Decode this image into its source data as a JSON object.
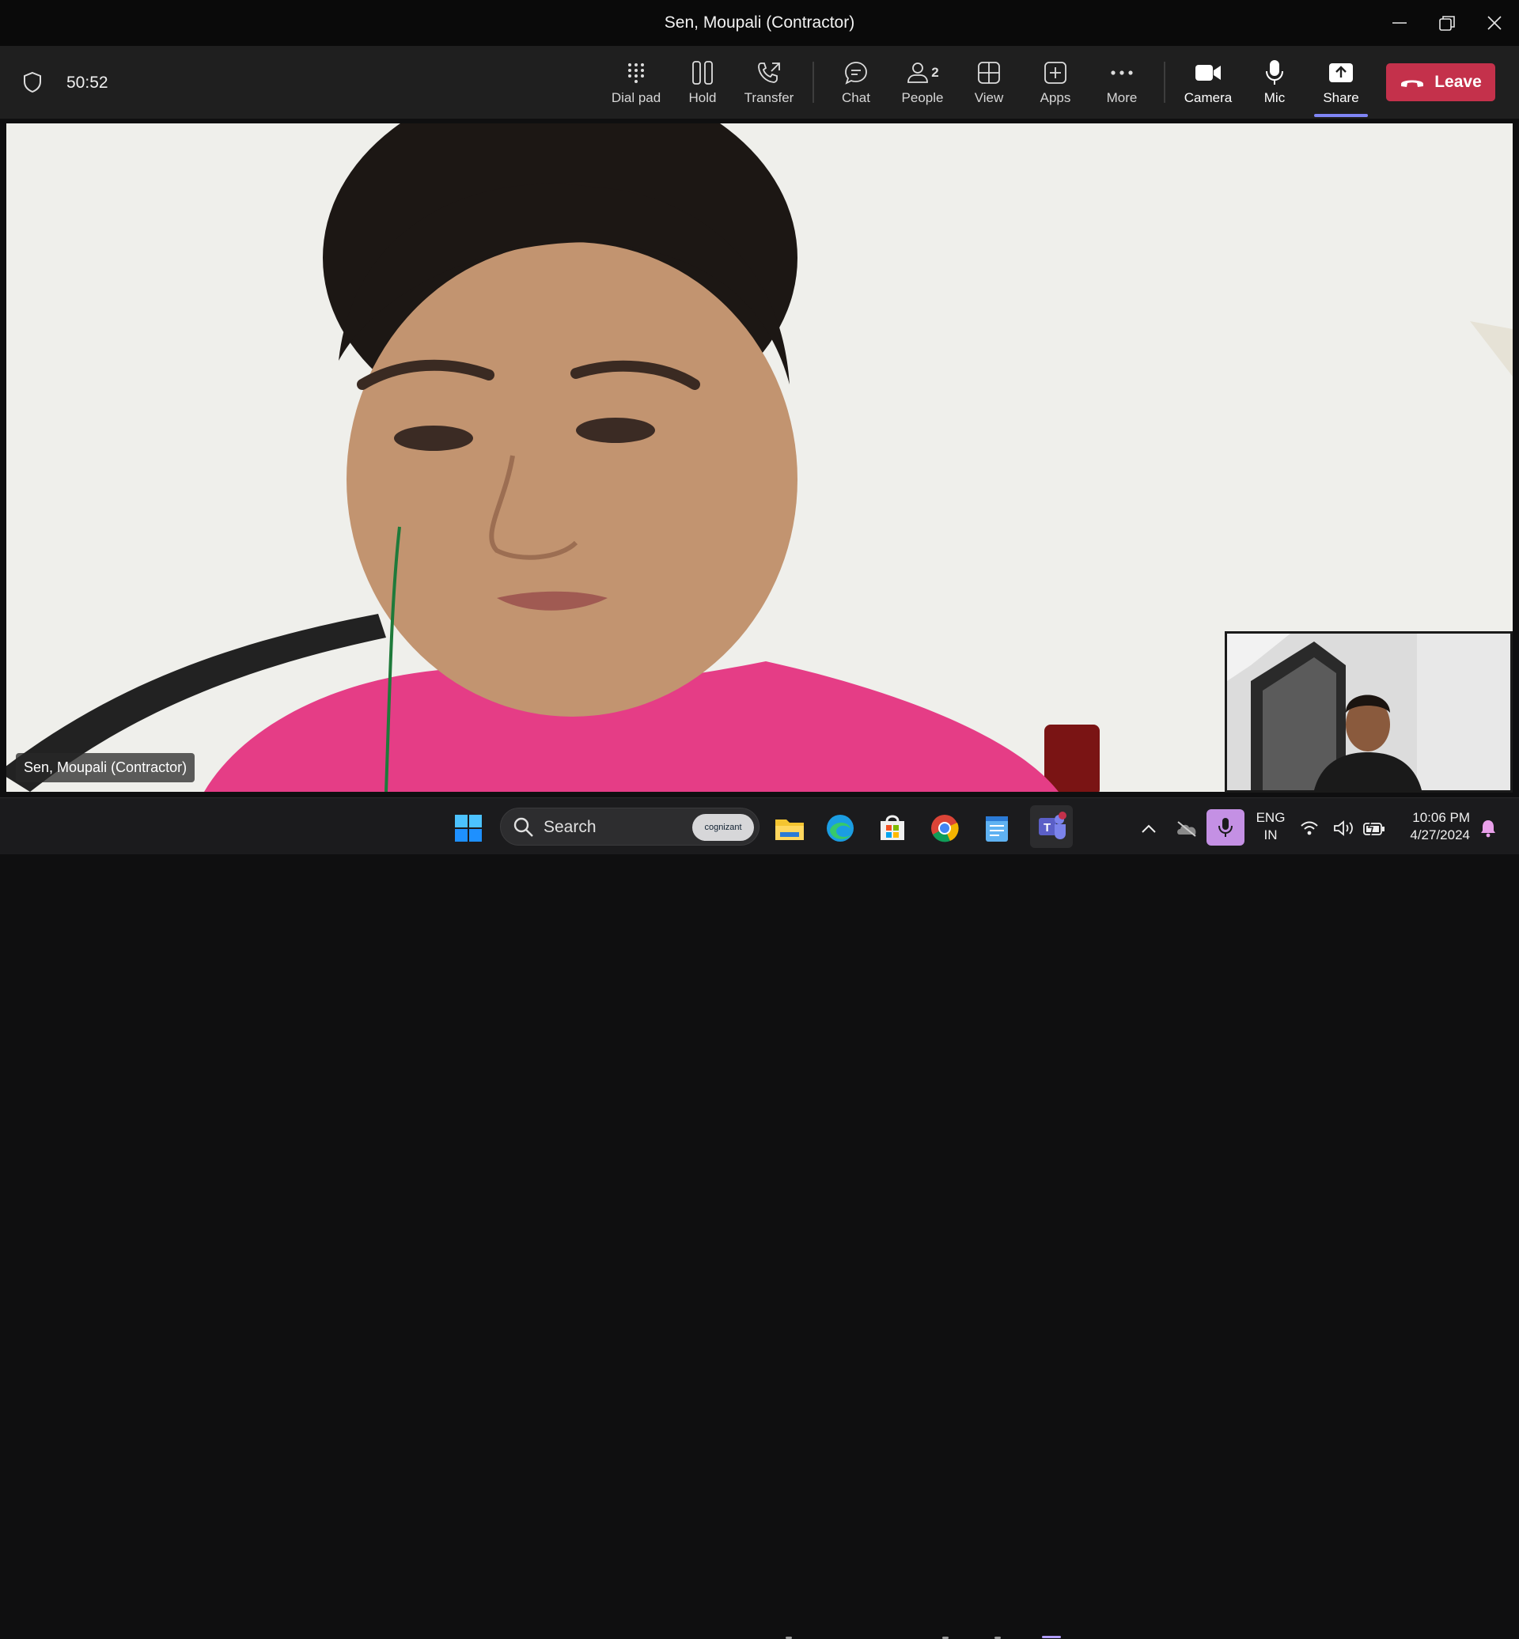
{
  "window": {
    "title": "Sen, Moupali (Contractor)"
  },
  "meeting": {
    "timer": "50:52",
    "toolbar": {
      "dial_pad": "Dial pad",
      "hold": "Hold",
      "transfer": "Transfer",
      "chat": "Chat",
      "people": "People",
      "people_count": "2",
      "view": "View",
      "apps": "Apps",
      "more": "More",
      "camera": "Camera",
      "mic": "Mic",
      "share": "Share",
      "leave": "Leave"
    },
    "participant_name": "Sen, Moupali (Contractor)"
  },
  "taskbar": {
    "search_label": "Search",
    "search_brand": "cognizant",
    "language_line1": "ENG",
    "language_line2": "IN",
    "time": "10:06 PM",
    "date": "4/27/2024"
  },
  "colors": {
    "leave_button": "#c4314b",
    "share_indicator": "#7f85f5",
    "toolbar_bg": "#1f1f1f",
    "mic_pill": "#c490e4"
  },
  "icons": {
    "titlebar": [
      "minimize-icon",
      "restore-icon",
      "close-icon"
    ],
    "toolbar": [
      "shield-icon",
      "dialpad-icon",
      "hold-icon",
      "transfer-icon",
      "chat-icon",
      "people-icon",
      "view-icon",
      "apps-icon",
      "more-icon",
      "camera-icon",
      "mic-icon",
      "share-icon",
      "phone-hangup-icon"
    ],
    "taskbar": [
      "windows-start-icon",
      "search-icon",
      "file-explorer-icon",
      "edge-icon",
      "store-icon",
      "chrome-icon",
      "notepad-icon",
      "teams-icon",
      "chevron-up-icon",
      "onedrive-icon",
      "microphone-icon",
      "wifi-icon",
      "volume-icon",
      "battery-icon",
      "notification-bell-icon"
    ]
  }
}
